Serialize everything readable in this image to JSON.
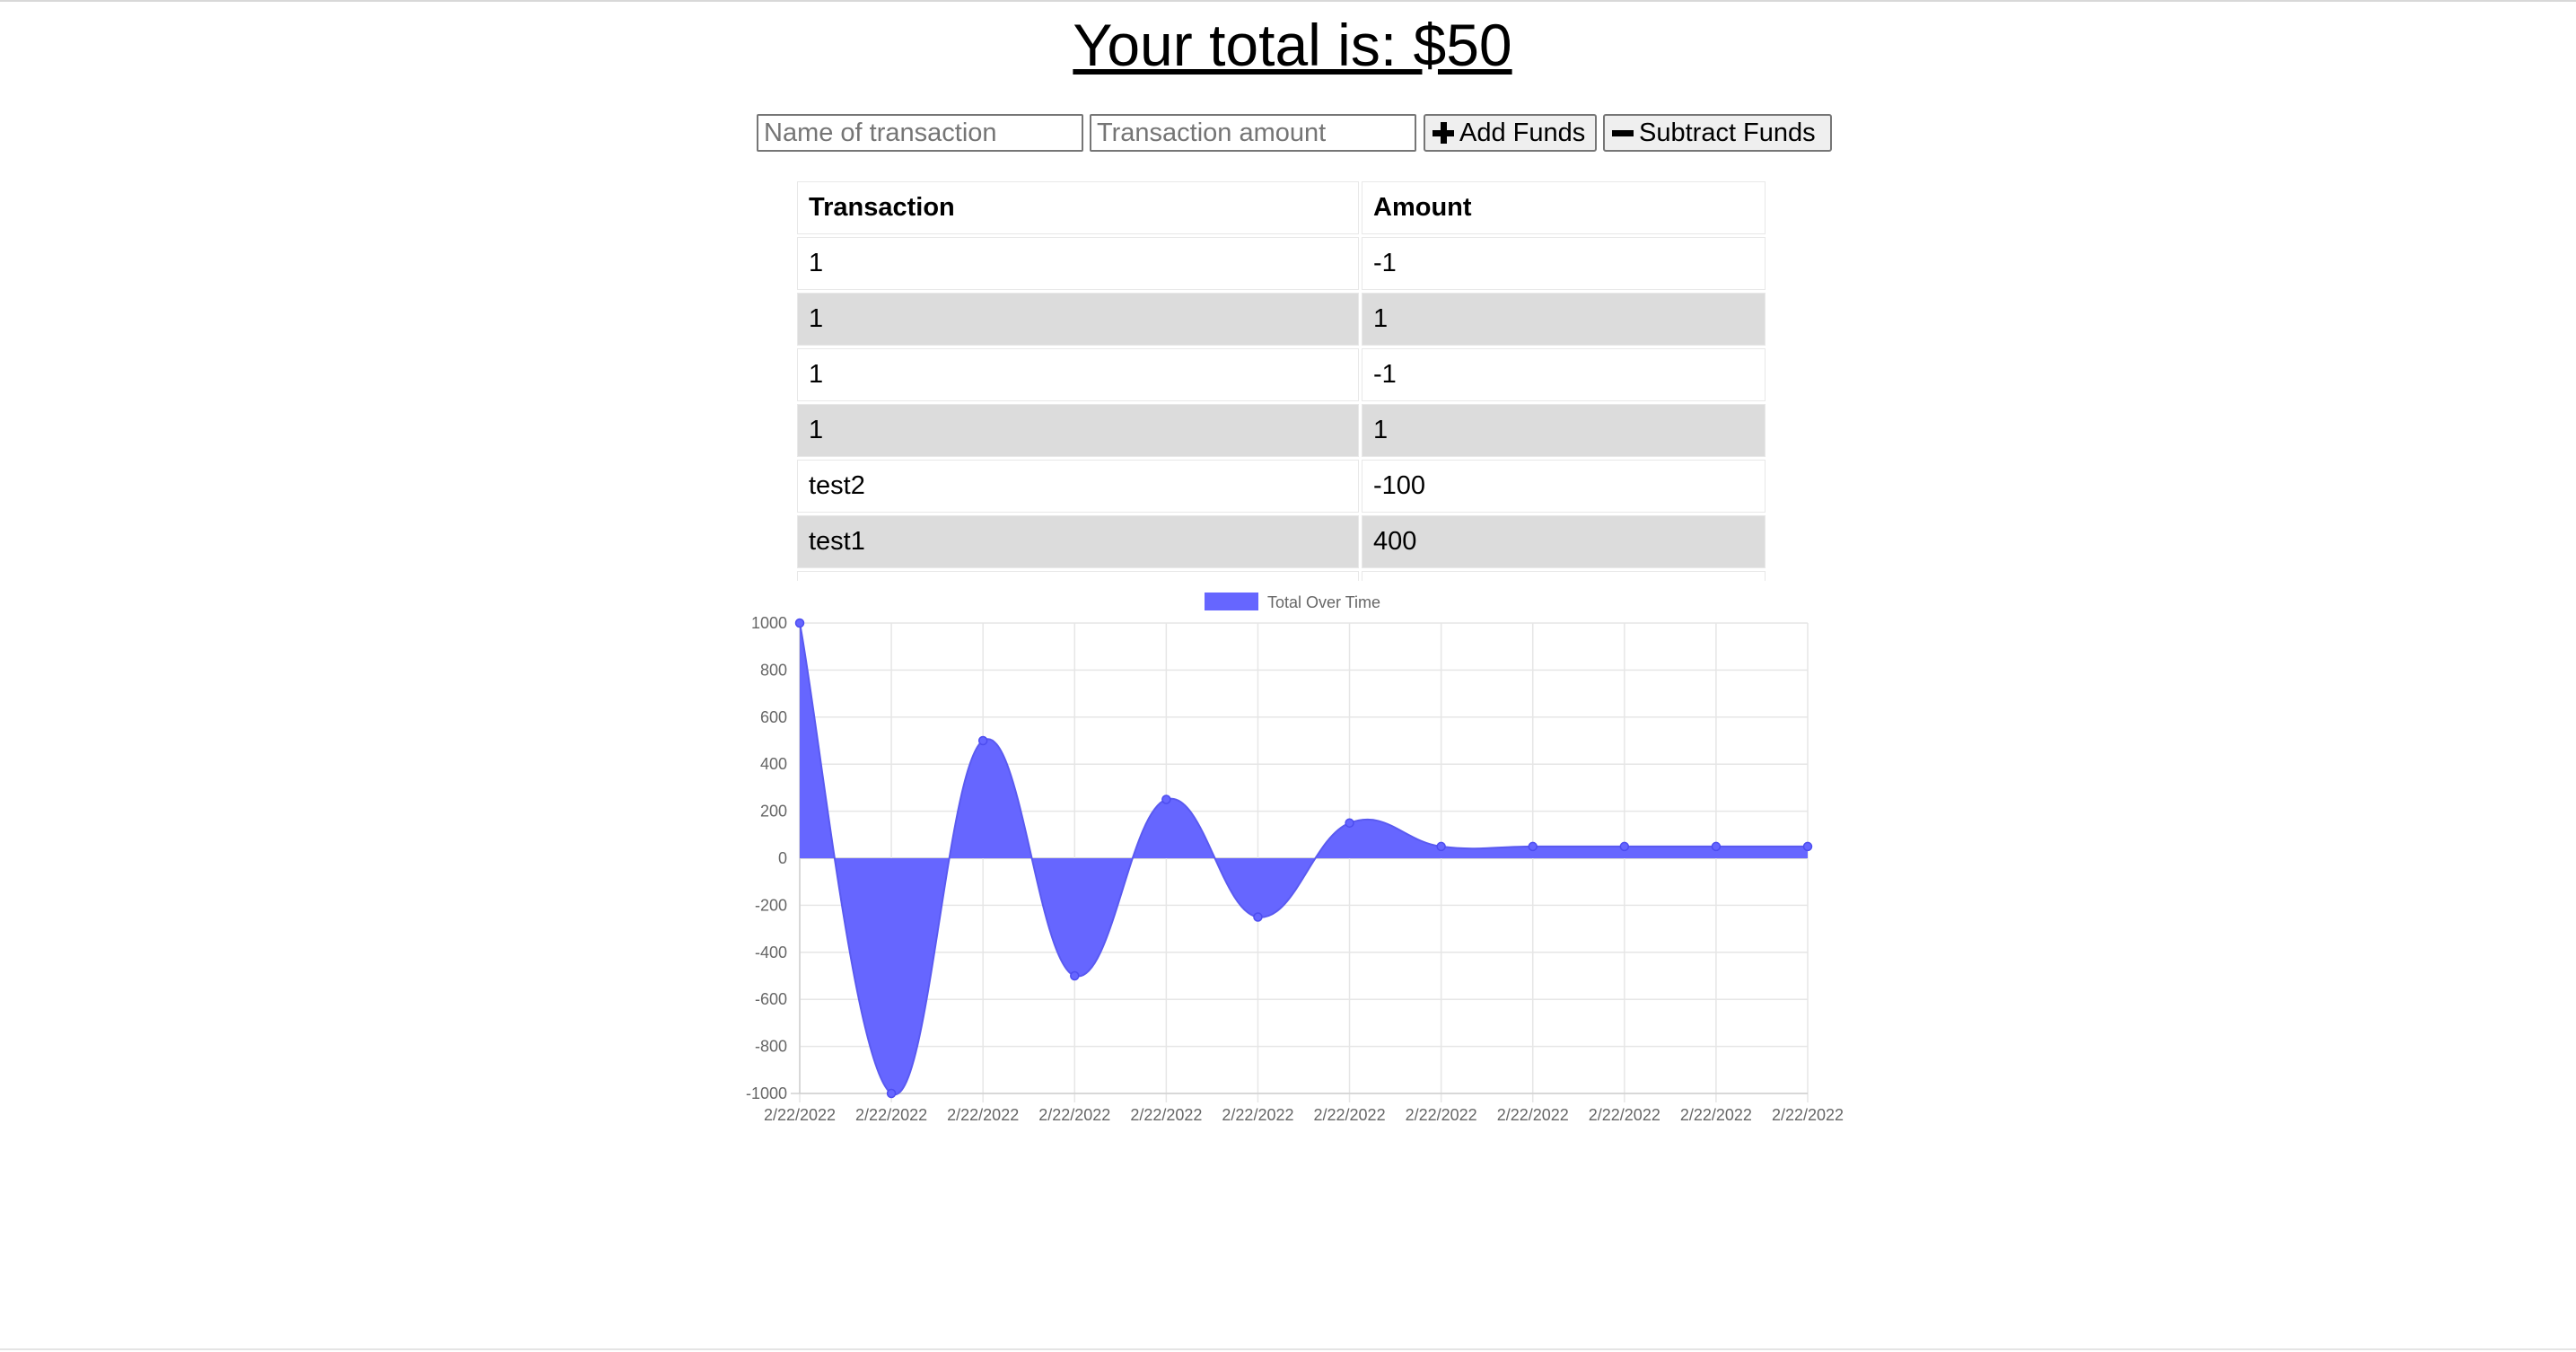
{
  "header": {
    "title": "Your total is: $50"
  },
  "form": {
    "name_placeholder": "Name of transaction",
    "amount_placeholder": "Transaction amount",
    "add_label": "Add Funds",
    "subtract_label": "Subtract Funds",
    "add_icon": "plus-icon",
    "subtract_icon": "minus-icon"
  },
  "table": {
    "headers": [
      "Transaction",
      "Amount"
    ],
    "rows": [
      {
        "name": "1",
        "amount": "-1"
      },
      {
        "name": "1",
        "amount": "1"
      },
      {
        "name": "1",
        "amount": "-1"
      },
      {
        "name": "1",
        "amount": "1"
      },
      {
        "name": "test2",
        "amount": "-100"
      },
      {
        "name": "test1",
        "amount": "400"
      }
    ]
  },
  "chart_data": {
    "type": "area",
    "legend": "Total Over Time",
    "legend_position": "top",
    "color": "#6666ff",
    "categories": [
      "2/22/2022",
      "2/22/2022",
      "2/22/2022",
      "2/22/2022",
      "2/22/2022",
      "2/22/2022",
      "2/22/2022",
      "2/22/2022",
      "2/22/2022",
      "2/22/2022",
      "2/22/2022",
      "2/22/2022"
    ],
    "values": [
      1000,
      -1000,
      500,
      -500,
      250,
      -250,
      150,
      50,
      50,
      50,
      50,
      50
    ],
    "yticks": [
      1000,
      800,
      600,
      400,
      200,
      0,
      -200,
      -400,
      -600,
      -800,
      -1000
    ],
    "ylim": [
      -1000,
      1000
    ],
    "grid": true
  }
}
